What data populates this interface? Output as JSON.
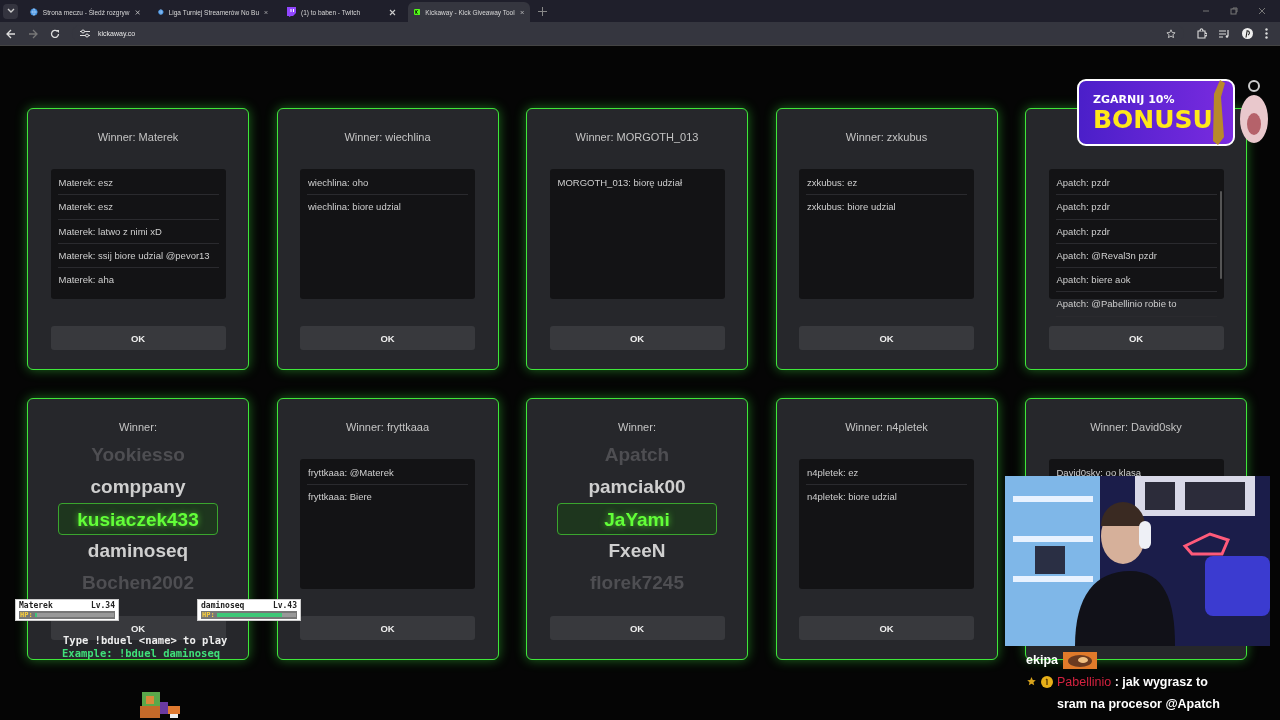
{
  "browser": {
    "tabs": [
      {
        "title": "Strona meczu - Śledź rozgryw",
        "selected": false
      },
      {
        "title": "Liga Turniej Streamerów No Bu",
        "selected": false
      },
      {
        "title": "(1) to baben - Twitch",
        "selected": false
      },
      {
        "title": "Kickaway - Kick Giveaway Tool",
        "selected": true
      }
    ],
    "url": "kickaway.co"
  },
  "cards": [
    {
      "kind": "messages",
      "title": "Winner: Materek",
      "messages": [
        "Materek: esz",
        "Materek: esz",
        "Materek: latwo z nimi xD",
        "Materek: ssij biore udzial @pevor13",
        "Materek: aha"
      ],
      "button": "OK"
    },
    {
      "kind": "messages",
      "title": "Winner: wiechlina",
      "messages": [
        "wiechlina: oho",
        "wiechlina: biore udzial"
      ],
      "button": "OK"
    },
    {
      "kind": "messages",
      "title": "Winner: MORGOTH_013",
      "messages": [
        "MORGOTH_013: biorę udział"
      ],
      "button": "OK"
    },
    {
      "kind": "messages",
      "title": "Winner: zxkubus",
      "messages": [
        "zxkubus: ez",
        "zxkubus: biore udzial"
      ],
      "button": "OK"
    },
    {
      "kind": "messages",
      "scrollable": true,
      "messages": [
        "Apatch: pzdr",
        "Apatch: pzdr",
        "Apatch: pzdr",
        "Apatch: @Reval3n pzdr",
        "Apatch: biere aok",
        "Apatch: @Pabellinio robie to"
      ],
      "button": "OK"
    },
    {
      "kind": "roulette",
      "title": "Winner:",
      "names": [
        {
          "name": "Yookiesso",
          "selected": false
        },
        {
          "name": "comppany",
          "selected": false
        },
        {
          "name": "kusiaczek433",
          "selected": true
        },
        {
          "name": "daminoseq",
          "selected": false
        },
        {
          "name": "Bochen2002",
          "selected": false
        }
      ],
      "button": "OK"
    },
    {
      "kind": "messages",
      "title": "Winner: fryttkaaa",
      "messages": [
        "fryttkaaa: @Materek",
        "fryttkaaa: Biere"
      ],
      "button": "OK"
    },
    {
      "kind": "roulette",
      "title": "Winner:",
      "names": [
        {
          "name": "Apatch",
          "selected": false
        },
        {
          "name": "pamciak00",
          "selected": false
        },
        {
          "name": "JaYami",
          "selected": true
        },
        {
          "name": "FxeeN",
          "selected": false
        },
        {
          "name": "florek7245",
          "selected": false
        }
      ],
      "button": "OK"
    },
    {
      "kind": "messages",
      "title": "Winner: n4pletek",
      "messages": [
        "n4pletek: ez",
        "n4pletek: biore udzial"
      ],
      "button": "OK"
    },
    {
      "kind": "messages",
      "title": "Winner: David0sky",
      "messages": [
        "David0sky: oo klasa"
      ]
    }
  ],
  "promo": {
    "line_1": "ZGARNIJ 10%",
    "line_2": "BONUSU"
  },
  "duel": {
    "players": [
      {
        "name": "Materek",
        "lv": "Lv.34",
        "hp_label": "HP:",
        "level": 0.03
      },
      {
        "name": "daminoseq",
        "lv": "Lv.43",
        "hp_label": "HP:",
        "level": 0.82
      }
    ],
    "instruction": "Type !bduel <name> to play",
    "example": "Example: !bduel daminoseq"
  },
  "chat": [
    {
      "kind": "emote",
      "text": "ekipa"
    },
    {
      "kind": "message",
      "user": "Pabellinio",
      "color": "#d4223f",
      "text": ": jak wygrasz to sram na procesor @Apatch"
    }
  ]
}
